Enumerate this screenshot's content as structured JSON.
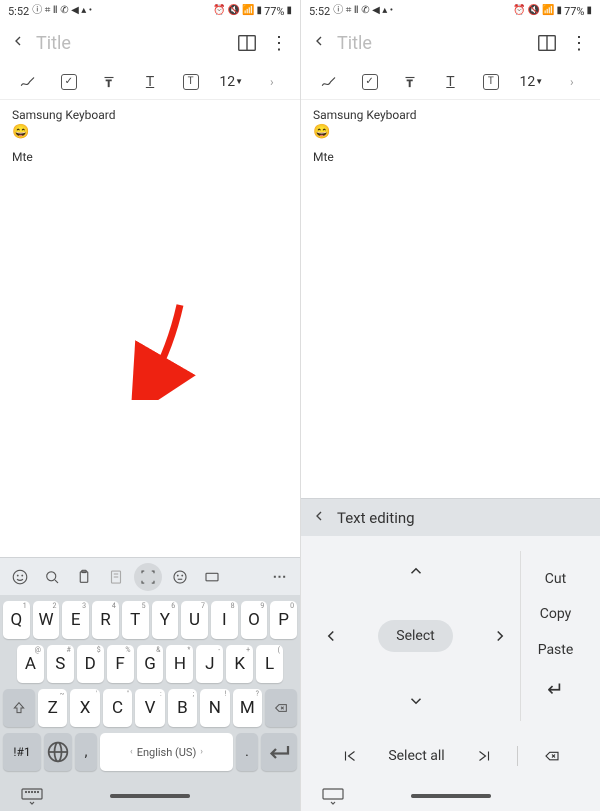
{
  "status": {
    "time": "5:52",
    "battery": "77%"
  },
  "header": {
    "title_placeholder": "Title"
  },
  "toolbar": {
    "font_size": "12",
    "text_icon_t": "T"
  },
  "note": {
    "line1": "Samsung Keyboard",
    "emoji": "😄",
    "line2": "Mte"
  },
  "keyboard": {
    "rows": [
      [
        {
          "k": "Q",
          "s": "1"
        },
        {
          "k": "W",
          "s": "2"
        },
        {
          "k": "E",
          "s": "3"
        },
        {
          "k": "R",
          "s": "4"
        },
        {
          "k": "T",
          "s": "5"
        },
        {
          "k": "Y",
          "s": "6"
        },
        {
          "k": "U",
          "s": "7"
        },
        {
          "k": "I",
          "s": "8"
        },
        {
          "k": "O",
          "s": "9"
        },
        {
          "k": "P",
          "s": "0"
        }
      ],
      [
        {
          "k": "A",
          "s": "@"
        },
        {
          "k": "S",
          "s": "#"
        },
        {
          "k": "D",
          "s": "$"
        },
        {
          "k": "F",
          "s": "%"
        },
        {
          "k": "G",
          "s": "&"
        },
        {
          "k": "H",
          "s": "*"
        },
        {
          "k": "J",
          "s": "-"
        },
        {
          "k": "K",
          "s": "+"
        },
        {
          "k": "L",
          "s": "("
        }
      ],
      [
        {
          "k": "Z",
          "s": "~"
        },
        {
          "k": "X",
          "s": "'"
        },
        {
          "k": "C",
          "s": "\""
        },
        {
          "k": "V",
          "s": ":"
        },
        {
          "k": "B",
          "s": ";"
        },
        {
          "k": "N",
          "s": "!"
        },
        {
          "k": "M",
          "s": "?"
        }
      ]
    ],
    "sym_label": "!#1",
    "space_label": "English (US)",
    "comma": ",",
    "period": "."
  },
  "text_editing": {
    "header": "Text editing",
    "select": "Select",
    "cut": "Cut",
    "copy": "Copy",
    "paste": "Paste",
    "select_all": "Select all"
  }
}
